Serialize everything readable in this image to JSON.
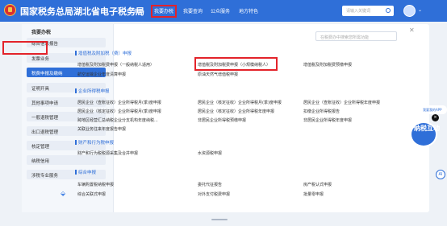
{
  "header": {
    "site_title": "国家税务总局湖北省电子税务局",
    "nav": [
      "首页",
      "我要办税",
      "我要查询",
      "公众服务",
      "地方特色"
    ],
    "search_placeholder": "请输入关键词"
  },
  "sidebar": {
    "title": "我要办税",
    "items": [
      "综合信息报告",
      "发票业务",
      "税费申报及缴纳",
      "证明开具",
      "其他事项申请",
      "一般退税管理",
      "出口退税管理",
      "核定管理",
      "纳税信用",
      "涉税专业服务"
    ],
    "active_index": 2
  },
  "content": {
    "search_placeholder": "在税费办中搜索您所需功能",
    "sections": [
      {
        "title": "增值税及附加税（费）申报",
        "links": [
          "增值税及附加税费申报（一般纳税人适用）",
          "增值税及附加税费申报（小规模纳税人）",
          "增值税及附加税费预缴申报",
          "航空运输企业年度清算申报",
          "原油天然气增值税申报"
        ]
      },
      {
        "title": "企业所得税申报",
        "links": [
          "居民企业（查账征收）企业所得税月(季)度申报",
          "居民企业（核定征收）企业所得税月(季)度申报",
          "居民企业（查账征收）企业所得税年度申报",
          "居民企业（核定征收）企业所得税月(季)度申报",
          "居民企业（核定征收）企业所得税年度申报",
          "扣缴企业所得税报告",
          "跨地区经营汇总纳税企业分支机构年度纳税...",
          "非居民企业所得税预缴申报",
          "非居民企业所得税年度申报",
          "关联业务往来年度报告申报"
        ]
      },
      {
        "title": "财产和行为税申报",
        "links": [
          "财产和行为税税源采集及合并申报",
          "水资源税申报"
        ]
      },
      {
        "title": "综合申报",
        "links": [
          "车辆购置税纳税申报",
          "委托代征报告",
          "房产税认式申报",
          "综合关联式申报",
          "对外支付税费申报",
          "批量零申报"
        ]
      }
    ]
  },
  "float": {
    "pill": "我要我的APP",
    "mascot": "纳税互动",
    "ai": "AI",
    "dot_icon": "close-icon"
  }
}
